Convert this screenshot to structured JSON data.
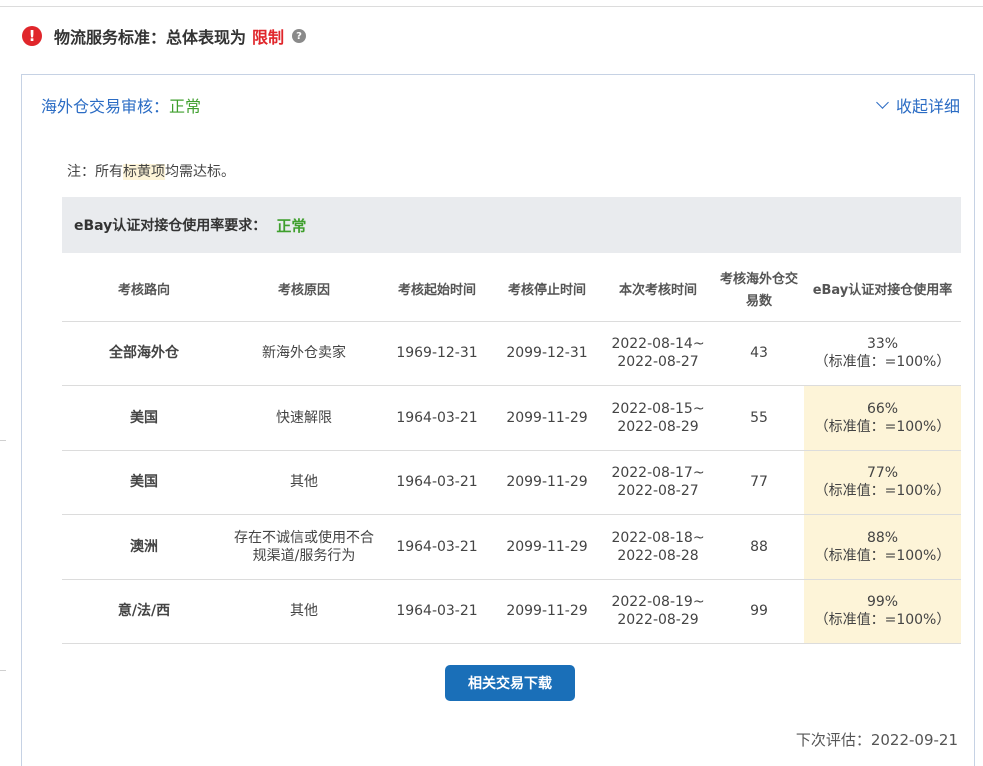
{
  "header": {
    "title": "物流服务标准：总体表现为",
    "status": "限制",
    "help_glyph": "?",
    "alert_glyph": "!"
  },
  "panel": {
    "title": "海外仓交易审核：",
    "status": "正常",
    "collapse_label": "收起详细"
  },
  "note": {
    "prefix": "注：所有",
    "highlight": "标黄项",
    "suffix": "均需达标。"
  },
  "section": {
    "label": "eBay认证对接仓使用率要求：",
    "status": "正常"
  },
  "table": {
    "headers": [
      "考核路向",
      "考核原因",
      "考核起始时间",
      "考核停止时间",
      "本次考核时间",
      "考核海外仓交易数",
      "eBay认证对接仓使用率"
    ],
    "rows": [
      {
        "route": "全部海外仓",
        "reason": "新海外仓卖家",
        "start": "1969-12-31",
        "stop": "2099-12-31",
        "period_start": "2022-08-14~",
        "period_end": "2022-08-27",
        "count": "43",
        "rate": "33%",
        "standard": "（标准值：=100%）",
        "highlight": false
      },
      {
        "route": "美国",
        "reason": "快速解限",
        "start": "1964-03-21",
        "stop": "2099-11-29",
        "period_start": "2022-08-15~",
        "period_end": "2022-08-29",
        "count": "55",
        "rate": "66%",
        "standard": "（标准值：=100%）",
        "highlight": true
      },
      {
        "route": "美国",
        "reason": "其他",
        "start": "1964-03-21",
        "stop": "2099-11-29",
        "period_start": "2022-08-17~",
        "period_end": "2022-08-27",
        "count": "77",
        "rate": "77%",
        "standard": "（标准值：=100%）",
        "highlight": true
      },
      {
        "route": "澳洲",
        "reason": "存在不诚信或使用不合规渠道/服务行为",
        "start": "1964-03-21",
        "stop": "2099-11-29",
        "period_start": "2022-08-18~",
        "period_end": "2022-08-28",
        "count": "88",
        "rate": "88%",
        "standard": "（标准值：=100%）",
        "highlight": true
      },
      {
        "route": "意/法/西",
        "reason": "其他",
        "start": "1964-03-21",
        "stop": "2099-11-29",
        "period_start": "2022-08-19~",
        "period_end": "2022-08-29",
        "count": "99",
        "rate": "99%",
        "standard": "（标准值：=100%）",
        "highlight": true
      }
    ]
  },
  "download_button": "相关交易下载",
  "next_eval": "下次评估：2022-09-21",
  "colors": {
    "alert_red": "#e0262b",
    "link_blue": "#2b6cc4",
    "ok_green": "#3f9f2d",
    "highlight_yellow": "#fdf4d8",
    "button_blue": "#1a6fb8"
  }
}
